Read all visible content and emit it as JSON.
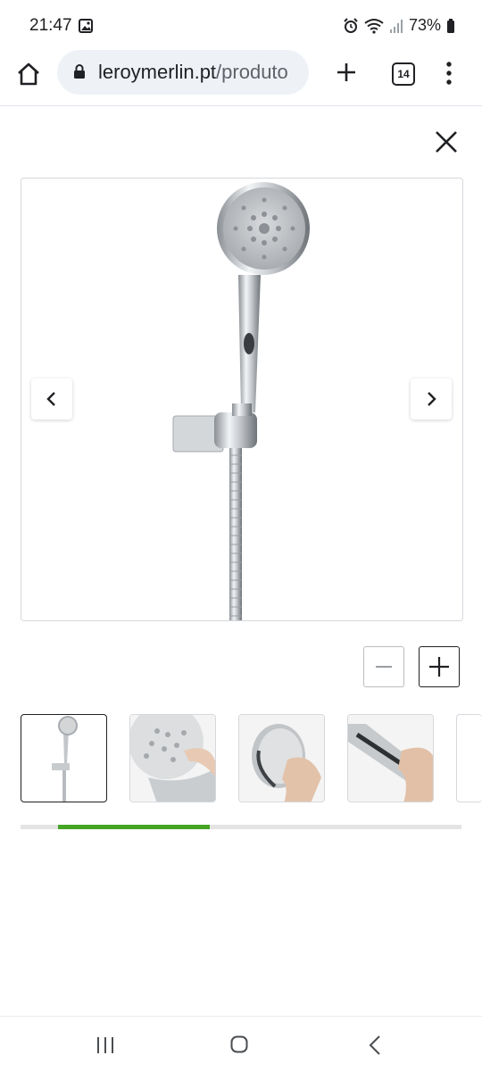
{
  "status_bar": {
    "time": "21:47",
    "battery": "73%",
    "icons": [
      "gallery-icon",
      "alarm-icon",
      "wifi-icon",
      "signal-icon",
      "battery-icon"
    ]
  },
  "browser": {
    "url_domain": "leroymerlin.pt",
    "url_path": "/produto",
    "tab_count": "14",
    "icons": [
      "home-icon",
      "lock-icon",
      "plus-icon",
      "tab-switcher-icon",
      "more-vert-icon"
    ]
  },
  "gallery": {
    "close_icon": "close-icon",
    "prev_icon": "chevron-left-icon",
    "next_icon": "chevron-right-icon",
    "zoom_out_icon": "minus-icon",
    "zoom_in_icon": "plus-icon",
    "thumbnails": [
      {
        "name": "thumbnail-shower-set",
        "active": true
      },
      {
        "name": "thumbnail-shower-head-closeup",
        "active": false
      },
      {
        "name": "thumbnail-shower-head-hand",
        "active": false
      },
      {
        "name": "thumbnail-shower-handle-hand",
        "active": false
      }
    ],
    "scroll_progress": {
      "start": 0.085,
      "end": 0.43
    },
    "accent_color": "#45a524"
  },
  "android_nav": {
    "icons": [
      "recents-icon",
      "home-circle-icon",
      "back-icon"
    ]
  }
}
